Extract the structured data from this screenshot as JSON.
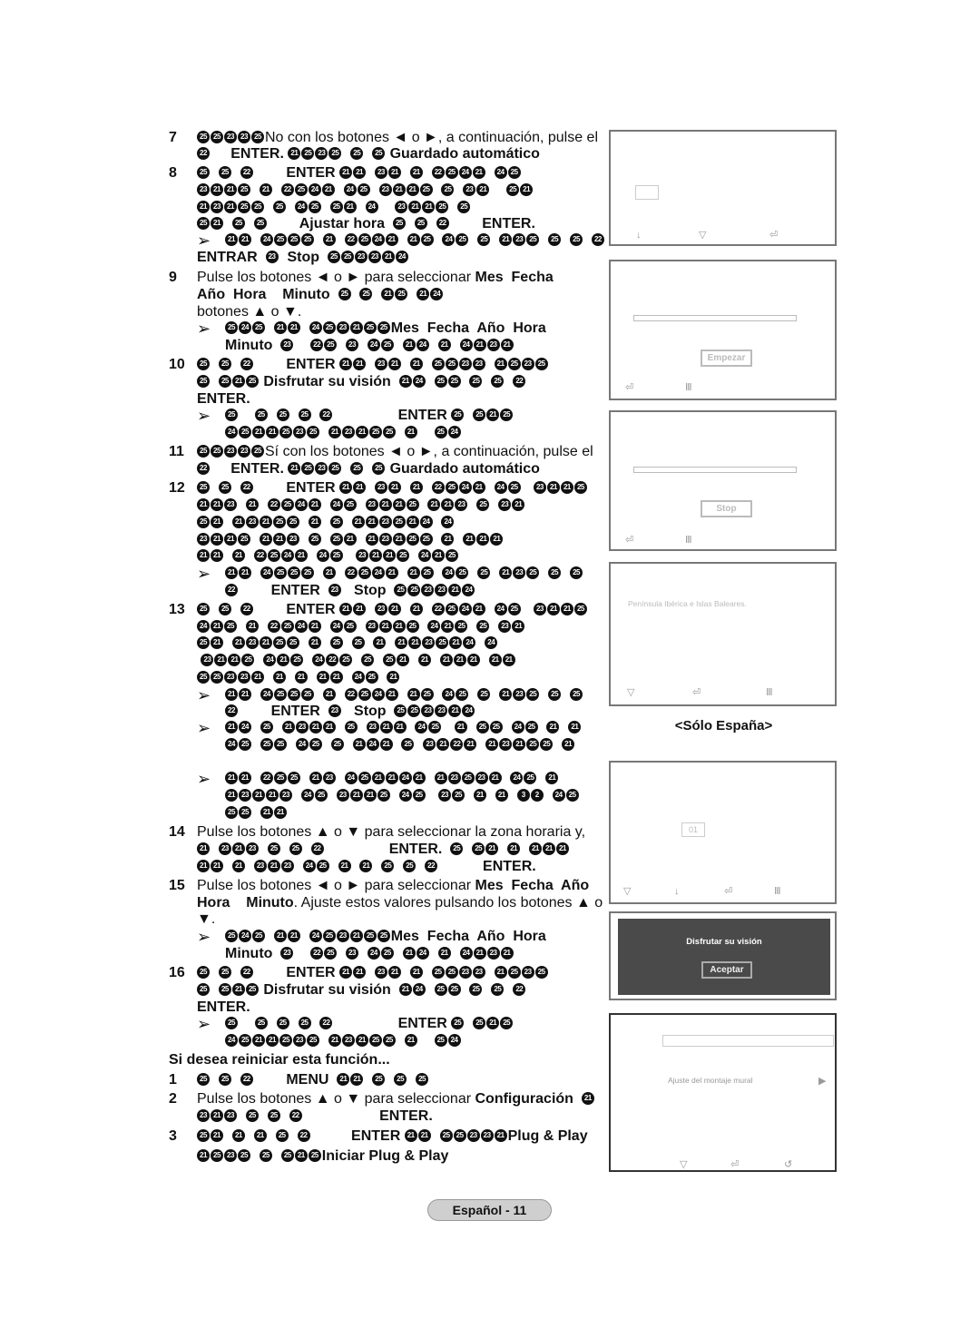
{
  "body": {
    "lines": [
      {
        "n": "7",
        "k": "step",
        "s": [
          "㉕㉕㉓㉓㉕",
          {
            "r": "No con los botones ◄ o ►, a continuación, pulse el"
          }
        ]
      },
      {
        "k": "cont",
        "s": [
          "㉒     ENTER. ㉑㉕㉓㉕  ㉕  ㉕ Guardado automático"
        ]
      },
      {
        "n": "8",
        "k": "step",
        "s": [
          "㉕  ㉕  ㉒        ENTER ㉑㉑  ㉓㉑  ㉑  ㉒㉕㉔㉑  ㉔㉕"
        ]
      },
      {
        "k": "cont",
        "s": [
          "㉓㉑㉑㉕  ㉑  ㉒㉕㉔㉑  ㉔㉕  ㉓㉑㉑㉕  ㉕  ㉓㉑    ㉕㉑"
        ]
      },
      {
        "k": "cont",
        "s": [
          "㉑㉓㉑㉕㉕  ㉕  ㉔㉕  ㉕㉑  ㉔    ㉓㉑㉑㉕  ㉕"
        ]
      },
      {
        "k": "cont",
        "s": [
          "㉕㉑  ㉕  ㉕        Ajustar hora  ㉕  ㉕  ㉒        ENTER."
        ]
      },
      {
        "k": "note",
        "s": [
          "㉑㉑  ㉔㉕㉕㉕  ㉑  ㉒㉕㉔㉑  ㉑㉕  ㉔㉕  ㉕  ㉑㉓㉕  ㉕  ㉕  ㉒"
        ]
      },
      {
        "k": "cont",
        "s": [
          "ENTRAR  ㉓  Stop  ㉕㉕㉓㉓㉑㉔"
        ]
      },
      {
        "n": "9",
        "k": "step",
        "s": [
          {
            "r": "Pulse los botones ◄ o ► para seleccionar "
          },
          "Mes  Fecha"
        ]
      },
      {
        "k": "cont",
        "s": [
          "Año  Hora    Minuto  ㉕  ㉕  ㉑㉕  ㉑㉔"
        ]
      },
      {
        "k": "cont",
        "s": [
          {
            "r": "botones ▲ o ▼."
          }
        ]
      },
      {
        "k": "note",
        "s": [
          "㉕㉔㉕  ㉑㉑  ㉔㉕㉓㉑㉕㉕Mes  Fecha  Año  Hora"
        ]
      },
      {
        "k": "notecont",
        "s": [
          "Minuto  ㉓    ㉒㉕  ㉓  ㉔㉕  ㉑㉔  ㉑  ㉔㉑㉓㉑"
        ]
      },
      {
        "n": "10",
        "k": "step",
        "s": [
          "㉕  ㉕  ㉒        ENTER ㉑㉑  ㉓㉑  ㉑  ㉕㉕㉓㉓  ㉑㉕㉓㉕"
        ]
      },
      {
        "k": "cont",
        "s": [
          "㉕  ㉕㉑㉕ Disfrutar su visión  ㉑㉔  ㉕㉕  ㉕  ㉕  ㉒"
        ]
      },
      {
        "k": "cont",
        "s": [
          "ENTER."
        ]
      },
      {
        "k": "note",
        "s": [
          "㉕    ㉕  ㉕  ㉕  ㉒                ENTER ㉕  ㉕㉑㉕"
        ]
      },
      {
        "k": "notecont",
        "s": [
          "㉔㉕㉑㉑㉕㉓㉕  ㉑㉓㉑㉕㉕  ㉑    ㉕㉔"
        ]
      },
      {
        "n": "11",
        "k": "step",
        "s": [
          "㉕㉕㉓㉓㉕",
          {
            "r": "Sí con los botones ◄ o ►, a continuación, pulse el"
          }
        ]
      },
      {
        "k": "cont",
        "s": [
          "㉒     ENTER. ㉑㉕㉓㉕  ㉕  ㉕ Guardado automático"
        ]
      },
      {
        "n": "12",
        "k": "step",
        "s": [
          "㉕  ㉕  ㉒        ENTER ㉑㉑  ㉓㉑  ㉑  ㉒㉕㉔㉑  ㉔㉕   ㉓㉑㉑㉕"
        ]
      },
      {
        "k": "cont",
        "s": [
          "㉑㉑㉓  ㉑  ㉒㉕㉔㉑  ㉔㉕  ㉓㉑㉑㉕  ㉑㉑㉓  ㉕  ㉓㉑"
        ]
      },
      {
        "k": "cont",
        "s": [
          "㉕㉑  ㉑㉓㉑㉕㉕  ㉑  ㉕  ㉑㉑㉓㉕㉑㉔  ㉔"
        ]
      },
      {
        "k": "cont",
        "s": [
          "㉓㉑㉑㉕  ㉑㉑㉓  ㉕  ㉕㉑  ㉑㉓㉑㉕㉕  ㉑  ㉑㉑㉑"
        ]
      },
      {
        "k": "cont",
        "s": [
          "㉑㉑  ㉑  ㉒㉕㉔㉑  ㉔㉕   ㉓㉑㉑㉕  ㉔㉑㉕"
        ]
      },
      {
        "k": "note",
        "s": [
          "㉑㉑  ㉔㉕㉕㉕  ㉑  ㉒㉕㉔㉑  ㉑㉕  ㉔㉕  ㉕  ㉑㉓㉕  ㉕  ㉕"
        ]
      },
      {
        "k": "notecont",
        "s": [
          "㉒        ENTER  ㉓   Stop  ㉕㉕㉓㉓㉑㉔"
        ]
      },
      {
        "n": "13",
        "k": "step",
        "s": [
          "㉕  ㉕  ㉒        ENTER ㉑㉑  ㉓㉑  ㉑  ㉒㉕㉔㉑  ㉔㉕   ㉓㉑㉑㉕"
        ]
      },
      {
        "k": "cont",
        "s": [
          "㉔㉑㉕  ㉑  ㉒㉕㉔㉑  ㉔㉕  ㉓㉑㉑㉕  ㉔㉑㉕  ㉕  ㉓㉑"
        ]
      },
      {
        "k": "cont",
        "s": [
          "㉕㉑  ㉑㉓㉑㉕㉕  ㉑  ㉕  ㉕  ㉑  ㉑㉑㉓㉕㉑㉔  ㉔"
        ]
      },
      {
        "k": "cont",
        "s": [
          " ㉓㉑㉑㉕  ㉔㉑㉕  ㉔㉒㉕  ㉕  ㉕㉑  ㉑  ㉑㉑㉑  ㉑㉑"
        ]
      },
      {
        "k": "cont",
        "s": [
          "㉕㉕㉓㉓㉑  ㉑  ㉑  ㉑㉑  ㉔㉕  ㉑"
        ]
      },
      {
        "k": "note",
        "s": [
          "㉑㉑  ㉔㉕㉕㉕  ㉑  ㉒㉕㉔㉑  ㉑㉕  ㉔㉕  ㉕  ㉑㉓㉕  ㉕  ㉕"
        ]
      },
      {
        "k": "notecont",
        "s": [
          "㉒        ENTER  ㉓   Stop  ㉕㉕㉓㉓㉑㉔"
        ]
      },
      {
        "k": "note",
        "s": [
          "㉑㉔  ㉕  ㉑㉓㉑㉑  ㉕  ㉓㉑㉑  ㉔㉕   ㉑  ㉕㉕  ㉔㉕  ㉑  ㉑"
        ]
      },
      {
        "k": "notecont",
        "s": [
          "㉔㉕  ㉕㉕  ㉔㉕  ㉕  ㉑㉔㉑  ㉕  ㉓㉑㉒㉑  ㉑㉓㉑㉕㉕  ㉑"
        ]
      },
      {
        "k": "note",
        "s": [
          "㉑㉑  ㉒㉕㉕  ㉑㉓  ㉔㉕㉑㉑㉔㉑  ㉑㉓㉕㉓㉑  ㉔㉕  ㉑"
        ]
      },
      {
        "k": "notecont",
        "s": [
          "㉑㉓㉑㉑㉓  ㉔㉕  ㉓㉑㉑㉕  ㉔㉕   ㉓㉕  ㉑  ㉑  ❸❷  ㉔㉕"
        ]
      },
      {
        "k": "notecont",
        "s": [
          "㉕㉕  ㉑㉑"
        ]
      },
      {
        "n": "14",
        "k": "step",
        "s": [
          {
            "r": "Pulse los botones ▲ o ▼ para seleccionar la zona horaria y,"
          }
        ]
      },
      {
        "k": "cont",
        "s": [
          "㉑  ㉓㉑㉓  ㉕  ㉕  ㉒                ENTER.  ㉕  ㉕㉑  ㉑  ㉑㉑㉑"
        ]
      },
      {
        "k": "cont",
        "s": [
          "㉑㉑  ㉑  ㉓㉑㉓  ㉔㉕  ㉑  ㉑  ㉕  ㉕  ㉒           ENTER."
        ]
      },
      {
        "n": "15",
        "k": "step",
        "s": [
          {
            "r": "Pulse los botones ◄ o ► para seleccionar "
          },
          "Mes  Fecha  Año"
        ]
      },
      {
        "k": "cont",
        "s": [
          "Hora    Minuto",
          {
            "r": ". Ajuste estos valores pulsando los botones ▲ o"
          }
        ]
      },
      {
        "k": "cont",
        "s": [
          {
            "r": "▼."
          }
        ]
      },
      {
        "k": "note",
        "s": [
          "㉕㉔㉕  ㉑㉑  ㉔㉕㉓㉑㉕㉕Mes  Fecha  Año  Hora"
        ]
      },
      {
        "k": "notecont",
        "s": [
          "Minuto  ㉓    ㉒㉕  ㉓  ㉔㉕  ㉑㉔  ㉑  ㉔㉑㉓㉑"
        ]
      },
      {
        "n": "16",
        "k": "step",
        "s": [
          "㉕  ㉕  ㉒        ENTER ㉑㉑  ㉓㉑  ㉑  ㉕㉕㉓㉓  ㉑㉕㉓㉕"
        ]
      },
      {
        "k": "cont",
        "s": [
          "㉕  ㉕㉑㉕ Disfrutar su visión  ㉑㉔  ㉕㉕  ㉕  ㉕  ㉒"
        ]
      },
      {
        "k": "cont",
        "s": [
          "ENTER."
        ]
      },
      {
        "k": "note",
        "s": [
          "㉕    ㉕  ㉕  ㉕  ㉒                ENTER ㉕  ㉕㉑㉕"
        ]
      },
      {
        "k": "notecont",
        "s": [
          "㉔㉕㉑㉑㉕㉓㉕  ㉑㉓㉑㉕㉕  ㉑    ㉕㉔"
        ]
      },
      {
        "k": "heading",
        "s": [
          "Si desea reiniciar esta función..."
        ]
      },
      {
        "n": "1",
        "k": "step",
        "s": [
          "㉕  ㉕  ㉒        MENU  ㉑㉑  ㉕  ㉕  ㉕"
        ]
      },
      {
        "n": "2",
        "k": "step",
        "s": [
          {
            "r": "Pulse los botones ▲ o ▼ para seleccionar "
          },
          "Configuración  ㉑"
        ]
      },
      {
        "k": "cont",
        "s": [
          "㉓㉑㉓  ㉕  ㉕  ㉒                   ENTER."
        ]
      },
      {
        "n": "3",
        "k": "step",
        "s": [
          "㉕㉑  ㉑  ㉑  ㉕  ㉒          ENTER ㉑㉑  ㉕㉕㉓㉓㉑Plug & Play"
        ]
      },
      {
        "k": "cont",
        "s": [
          "㉑㉕㉓㉕  ㉕  ㉕㉑㉕Iniciar Plug & Play"
        ]
      }
    ]
  },
  "note_icon": "➢",
  "panels": {
    "p2_button": "Empezar",
    "p3_button": "Stop",
    "p4_text": "Península Ibérica e Islas Baleares.",
    "caption": "<Sólo España>",
    "p5_value": "01",
    "p6_title": "Disfrutar su visión",
    "p6_button": "Aceptar",
    "p7_item": "Ajuste del montaje mural",
    "icons": {
      "move": "↓",
      "updown": "▽",
      "enter": "⏎",
      "menu": "Ⅲ",
      "return": "↺",
      "right": "▶"
    }
  },
  "footer": {
    "page_label": "Español - 11"
  },
  "colors": {
    "panel_dark": "#4a4a4a",
    "footer_pill": "#cfcfcf",
    "muted": "#bbbbbb"
  }
}
